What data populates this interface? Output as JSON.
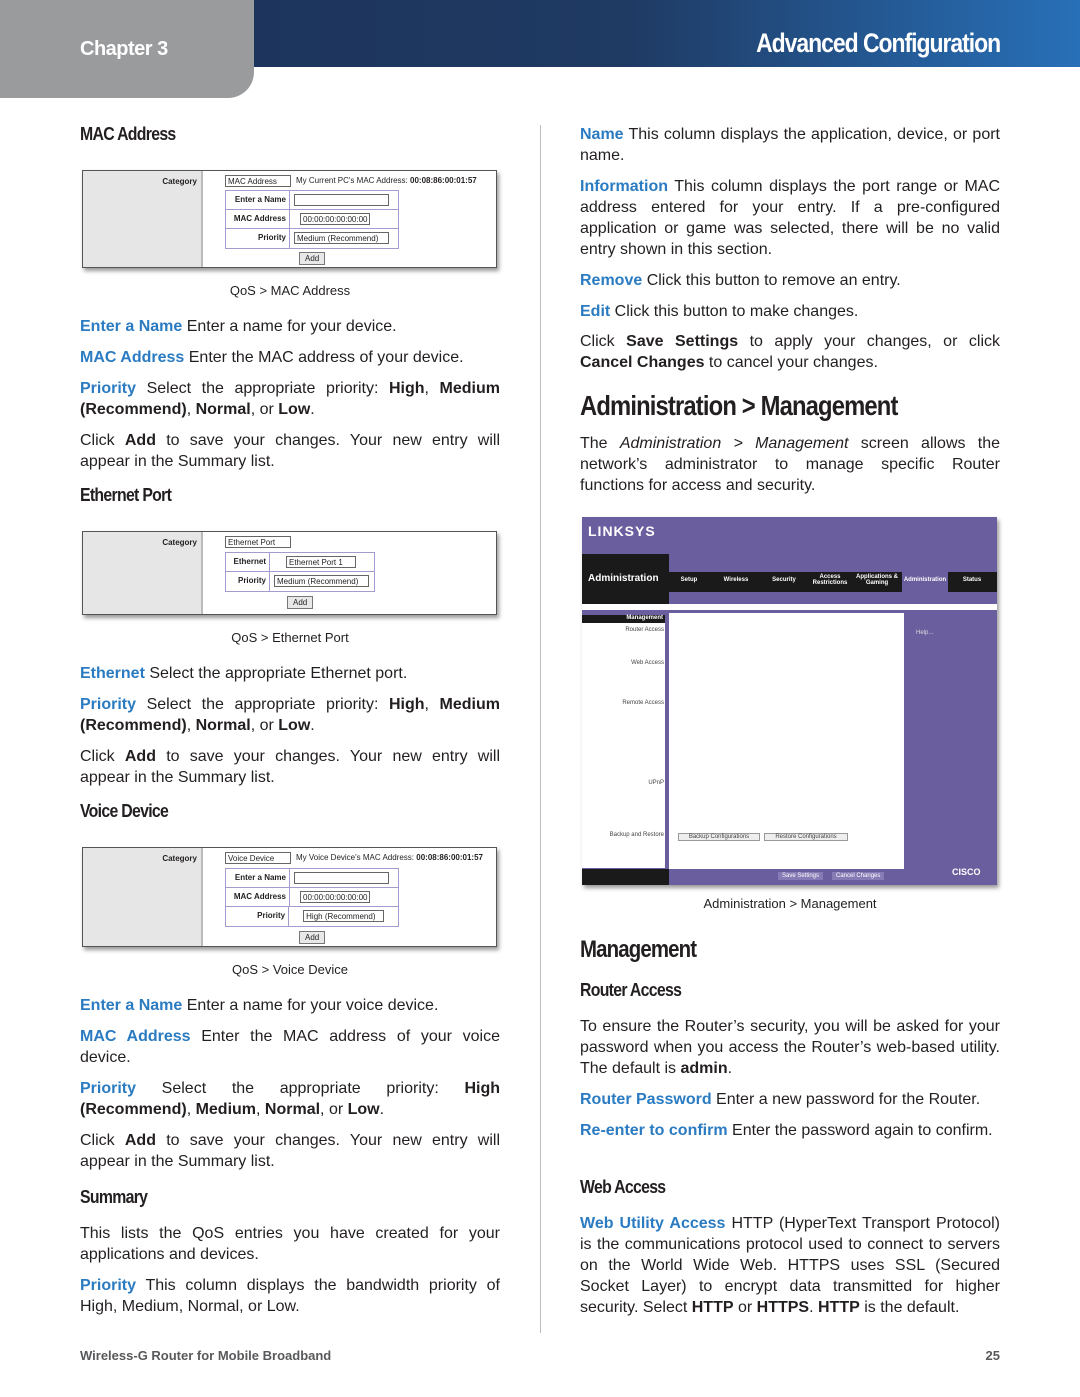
{
  "header": {
    "chapter": "Chapter 3",
    "title": "Advanced Configuration"
  },
  "left": {
    "mac_heading": "MAC Address",
    "fig1": {
      "category": "Category",
      "select": "MAC Address",
      "note": "My Current PC's MAC Address:",
      "mac": "00:08:86:00:01:57",
      "name_label": "Enter a Name",
      "mac_label": "MAC Address",
      "mac_value": "00:00:00:00:00:00",
      "priority_label": "Priority",
      "priority_value": "Medium (Recommend)",
      "add": "Add",
      "caption": "QoS > MAC Address"
    },
    "p1": {
      "term": "Enter a Name",
      "text": " Enter a name for your device."
    },
    "p2": {
      "term": "MAC Address",
      "text": " Enter the MAC address of your device."
    },
    "p3": {
      "term": "Priority",
      "t1": " Select the appropriate priority: ",
      "b1": "High",
      "t2": ", ",
      "b2": "Medium (Recommend)",
      "t3": ", ",
      "b3": "Normal",
      "t4": ", or ",
      "b4": "Low",
      "t5": "."
    },
    "p4": {
      "t1": "Click ",
      "b1": "Add",
      "t2": " to save your changes. Your new entry will appear in the Summary list."
    },
    "eth_heading": "Ethernet Port",
    "fig2": {
      "category": "Category",
      "select": "Ethernet Port",
      "eth_label": "Ethernet",
      "eth_value": "Ethernet Port 1",
      "priority_label": "Priority",
      "priority_value": "Medium (Recommend)",
      "add": "Add",
      "caption": "QoS > Ethernet Port"
    },
    "p5": {
      "term": "Ethernet",
      "text": " Select the appropriate Ethernet port."
    },
    "p6": {
      "term": "Priority",
      "t1": " Select the appropriate priority: ",
      "b1": "High",
      "t2": ", ",
      "b2": "Medium (Recommend)",
      "t3": ", ",
      "b3": "Normal",
      "t4": ", or ",
      "b4": "Low",
      "t5": "."
    },
    "p7": {
      "t1": "Click ",
      "b1": "Add",
      "t2": " to save your changes. Your new entry will appear in the Summary list."
    },
    "voice_heading": "Voice Device",
    "fig3": {
      "category": "Category",
      "select": "Voice Device",
      "note": "My Voice Device's MAC Address:",
      "mac": "00:08:86:00:01:57",
      "name_label": "Enter a Name",
      "mac_label": "MAC Address",
      "mac_value": "00:00:00:00:00:00",
      "priority_label": "Priority",
      "priority_value": "High (Recommend)",
      "add": "Add",
      "caption": "QoS > Voice Device"
    },
    "p8": {
      "term": "Enter a Name",
      "text": " Enter a name for your voice device."
    },
    "p9": {
      "term": "MAC Address",
      "text": " Enter the MAC address of your voice device."
    },
    "p10": {
      "term": "Priority",
      "t1": " Select the appropriate priority: ",
      "b1": "High (Recommend)",
      "t2": ", ",
      "b2": "Medium",
      "t3": ", ",
      "b3": "Normal",
      "t4": ", or ",
      "b4": "Low",
      "t5": "."
    },
    "p11": {
      "t1": "Click ",
      "b1": "Add",
      "t2": " to save your changes. Your new entry will appear in the Summary list."
    },
    "summary_heading": "Summary",
    "p12": "This lists the QoS entries you have created for your applications and devices.",
    "p13": {
      "term": "Priority",
      "text": " This column displays the bandwidth priority of High, Medium, Normal, or Low."
    }
  },
  "right": {
    "r1": {
      "term": "Name",
      "text": " This column displays the application, device, or port name."
    },
    "r2": {
      "term": "Information",
      "text": " This column displays the port range or MAC address entered for your entry. If a pre-configured application or game was selected, there will be no valid entry shown in this section."
    },
    "r3": {
      "term": "Remove",
      "text": " Click this button to remove an entry."
    },
    "r4": {
      "term": "Edit",
      "text": " Click this button to make changes."
    },
    "r5": {
      "t1": "Click ",
      "b1": "Save Settings",
      "t2": " to apply your changes, or click ",
      "b2": "Cancel Changes",
      "t3": " to cancel your changes."
    },
    "admin_heading": "Administration > Management",
    "r6": {
      "t1": "The ",
      "i1": "Administration > Management",
      "t2": " screen allows the network’s administrator to manage specific Router functions for access and security."
    },
    "fig": {
      "logo": "LINKSYS",
      "section": "Administration",
      "tabs": [
        "Setup",
        "Wireless",
        "Security",
        "Access Restrictions",
        "Applications & Gaming",
        "Administration",
        "Status"
      ],
      "sub": "Management",
      "labels": [
        "Router Access",
        "Web Access",
        "Remote Access",
        "UPnP",
        "Backup and Restore"
      ],
      "help": "Help...",
      "backup": "Backup Configurations",
      "restore": "Restore Configurations",
      "save": "Save Settings",
      "cancel": "Cancel Changes",
      "cisco": "CISCO",
      "caption": "Administration > Management"
    },
    "mgmt_heading": "Management",
    "ra_heading": "Router Access",
    "r7": {
      "t1": "To ensure the Router’s security, you will be asked for your password when you access the Router’s web-based utility. The default is ",
      "b1": "admin",
      "t2": "."
    },
    "r8": {
      "term": "Router Password",
      "text": " Enter a new password for the Router."
    },
    "r9": {
      "term": "Re-enter to confirm",
      "text": " Enter the password again to confirm."
    },
    "wa_heading": "Web Access",
    "r10": {
      "term": "Web Utility Access",
      "t1": " HTTP (HyperText Transport Protocol) is the communications protocol used to connect to servers on the World Wide Web. HTTPS uses SSL (Secured Socket Layer) to encrypt data transmitted for higher security. Select ",
      "b1": "HTTP",
      "t2": " or ",
      "b2": "HTTPS",
      "t3": ". ",
      "b3": "HTTP",
      "t4": " is the default."
    }
  },
  "footer": {
    "product": "Wireless-G Router for Mobile Broadband",
    "page": "25"
  }
}
